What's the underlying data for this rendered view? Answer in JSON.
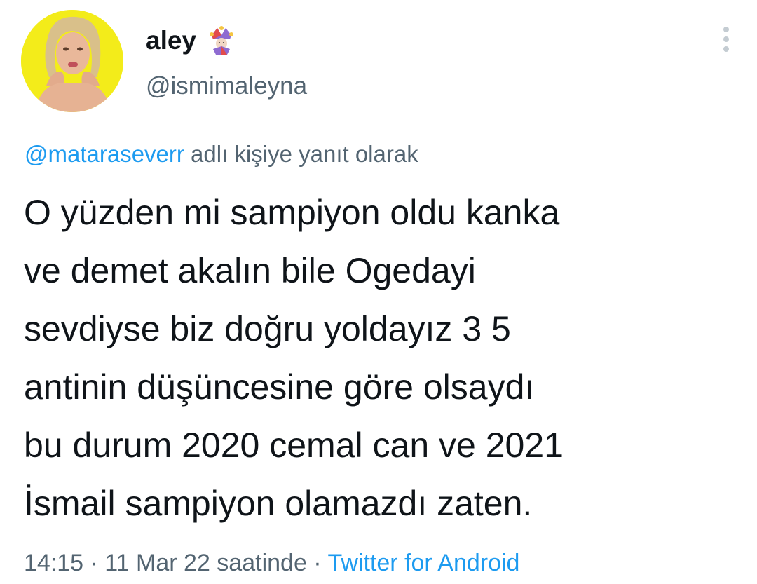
{
  "user": {
    "display_name": "aley",
    "handle": "@ismimaleyna",
    "name_emoji": "jester-icon",
    "avatar_bg": "#f3ec1a"
  },
  "reply": {
    "mention": "@mataraseverr",
    "suffix": " adlı kişiye yanıt olarak"
  },
  "tweet": {
    "text": "O yüzden mi sampiyon oldu kanka\nve demet akalın bile Ogedayi\nsevdiyse biz doğru yoldayız 3 5\nantinin düşüncesine göre olsaydı\nbu durum 2020 cemal can ve 2021\nİsmail sampiyon olamazdı zaten."
  },
  "meta": {
    "timestamp": "14:15 · 11 Mar 22 saatinde · ",
    "source": "Twitter for Android"
  },
  "colors": {
    "link": "#1d9bf0",
    "secondary": "#536471",
    "primary": "#0f1419"
  }
}
